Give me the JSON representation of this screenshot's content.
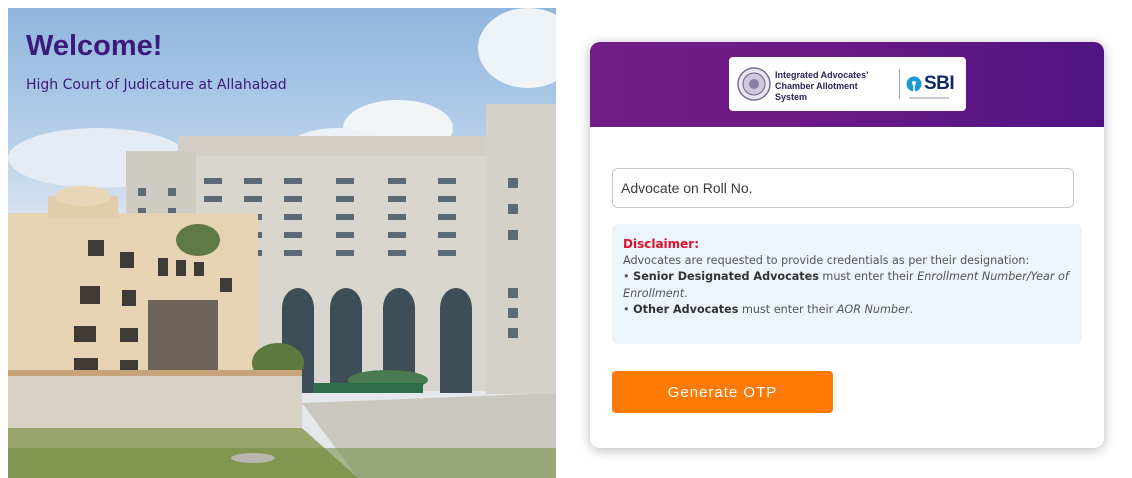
{
  "hero": {
    "welcome": "Welcome!",
    "court": "High Court of Judicature at Allahabad"
  },
  "logo": {
    "line1": "Integrated Advocates'",
    "line2": "Chamber Allotment System",
    "bank": "SBI"
  },
  "form": {
    "roll_placeholder": "Advocate on Roll No.",
    "button_label": "Generate OTP"
  },
  "disclaimer": {
    "title": "Disclaimer:",
    "intro": "Advocates are requested to provide credentials as per their designation:",
    "senior_label": "Senior Designated Advocates",
    "senior_text": " must enter their ",
    "senior_field": "Enrollment Number/Year of Enrollment",
    "other_label": "Other Advocates",
    "other_text": " must enter their ",
    "other_field": "AOR Number"
  },
  "colors": {
    "header_purple": "#6a1a86",
    "title_purple": "#3d1a7a",
    "button_orange": "#ff7b06",
    "disclaimer_red": "#e0102a"
  }
}
